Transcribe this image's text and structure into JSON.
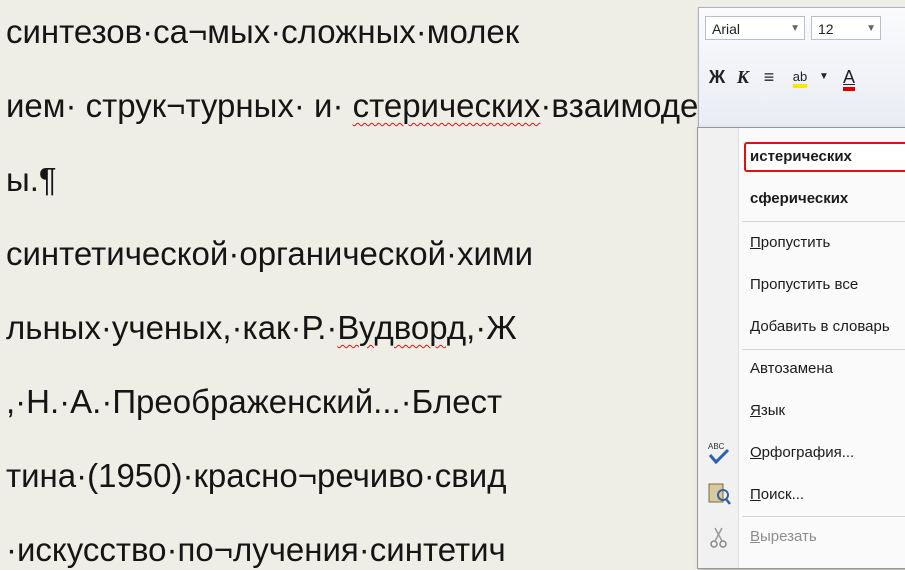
{
  "document": {
    "lines": [
      {
        "before": "синтезов·са¬мых·сложных·молек",
        "mark": "",
        "after": ""
      },
      {
        "before": "ием· струк¬турных· и· ",
        "mark": "стерических",
        "after": "·взаимоде"
      },
      {
        "before": "ы.¶",
        "mark": "",
        "after": ""
      },
      {
        "before": "синтетической·органической·хими",
        "mark": "",
        "after": ""
      },
      {
        "before": "льных·ученых,·как·Р.·",
        "mark": "Вудворд",
        "after": ",·Ж"
      },
      {
        "before": ",·Н.·А.·Преображенский...·Блест",
        "mark": "",
        "after": ""
      },
      {
        "before": "тина·(1950)·красно¬речиво·свид",
        "mark": "",
        "after": ""
      },
      {
        "before": "·искусство·по¬лучения·синтетич",
        "mark": "",
        "after": ""
      }
    ]
  },
  "mini_toolbar": {
    "font_name": "Arial",
    "font_size": "12",
    "bold": "Ж",
    "italic": "К",
    "align": "≡",
    "highlight": "ab",
    "font_color": "А",
    "colors": {
      "highlight": "#f6e800",
      "font_color": "#e00000"
    }
  },
  "context_menu": {
    "suggestions": [
      "истерических",
      "сферических"
    ],
    "items": [
      {
        "label": "Пропустить",
        "accel": "П",
        "rest": "ропустить"
      },
      {
        "label": "Пропустить все",
        "accel": "",
        "rest": "Пропустить все"
      },
      {
        "label": "Добавить в словарь",
        "accel": "Д",
        "rest": "обавить в словарь"
      },
      {
        "label": "Автозамена",
        "accel": "",
        "rest": "Автозамена"
      },
      {
        "label": "Язык",
        "accel": "Я",
        "rest": "зык"
      },
      {
        "label": "Орфография...",
        "accel": "О",
        "rest": "рфография..."
      },
      {
        "label": "Поиск...",
        "accel": "П",
        "rest": "оиск..."
      },
      {
        "label": "Вырезать",
        "accel": "В",
        "rest": "ырезать"
      }
    ],
    "icons": {
      "spelling": "spellcheck-icon",
      "search": "research-icon",
      "cut": "scissors-icon"
    }
  }
}
